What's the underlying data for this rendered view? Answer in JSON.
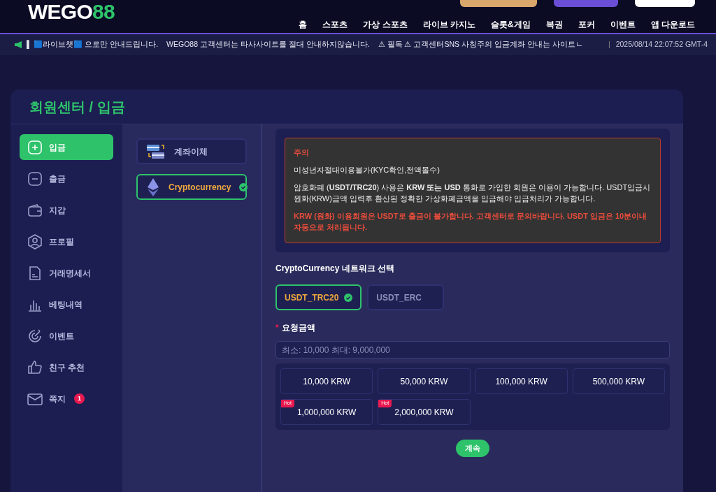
{
  "header": {
    "logo_text": "WEGO",
    "logo_digits": "88",
    "nav": [
      "홈",
      "스포츠",
      "가상 스포츠",
      "라이브 카지노",
      "슬롯&게임",
      "복권",
      "포커",
      "이벤트",
      "앱 다운로드"
    ]
  },
  "ticker": {
    "messages": [
      "▌ 🟦라이브챗🟦 으로만 안내드립니다.",
      "WEGO88 고객센터는 타사사이트를 절대 안내하지않습니다.",
      "⚠ 필독 ⚠ 고객센터SNS 사칭주의 입금계좌 안내는 사이트ㄴ"
    ],
    "separator": "|",
    "datetime": "2025/08/14 22:07:52 GMT-4"
  },
  "page_title": "회원센터 / 입금",
  "sidebar": [
    {
      "label": "입금",
      "kind": "plus",
      "selected": true
    },
    {
      "label": "출금",
      "kind": "minus",
      "selected": false
    },
    {
      "label": "지갑",
      "kind": "wallet",
      "selected": false
    },
    {
      "label": "프로필",
      "kind": "profile",
      "selected": false
    },
    {
      "label": "거래명세서",
      "kind": "doc",
      "selected": false
    },
    {
      "label": "베팅내역",
      "kind": "chart",
      "selected": false
    },
    {
      "label": "이벤트",
      "kind": "target",
      "selected": false
    },
    {
      "label": "친구 추천",
      "kind": "thumb",
      "selected": false
    },
    {
      "label": "쪽지",
      "kind": "mail",
      "selected": false,
      "badge": "1"
    }
  ],
  "methods": [
    {
      "label": "계좌이체",
      "kind": "cards",
      "selected": false
    },
    {
      "label": "Cryptocurrency",
      "kind": "eth",
      "selected": true
    }
  ],
  "notice": {
    "title": "주의",
    "lines": [
      "미성년자절대이용불가(KYC확인,전액몰수)",
      "암호화폐 (**USDT/TRC20**) 사용은 **KRW 또는 USD** 통화로 가입한 회원은 이용이 가능합니다. USDT입금시 원화(KRW)금액 입력후 환산된 정확한 가상화폐금액을 입금해야 입금처리가 가능합니다."
    ],
    "warning": "KRW (원화) 이용회원은 USDT로 출금이 불가합니다. 고객센터로 문의바랍니다. USDT 입금은 10분이내 자동으로 처리됩니다."
  },
  "network": {
    "label": "CryptoCurrency 네트워크 선택",
    "options": [
      {
        "label": "USDT_TRC20",
        "selected": true
      },
      {
        "label": "USDT_ERC",
        "selected": false
      }
    ]
  },
  "amount": {
    "required_mark": "*",
    "label": "요청금액",
    "placeholder": "최소: 10,000 최대: 9,000,000",
    "presets": [
      {
        "label": "10,000 KRW"
      },
      {
        "label": "50,000 KRW"
      },
      {
        "label": "100,000 KRW"
      },
      {
        "label": "500,000 KRW"
      },
      {
        "label": "1,000,000 KRW",
        "tag": "Hot"
      },
      {
        "label": "2,000,000 KRW",
        "tag": "Hot"
      }
    ]
  },
  "submit": "계속"
}
